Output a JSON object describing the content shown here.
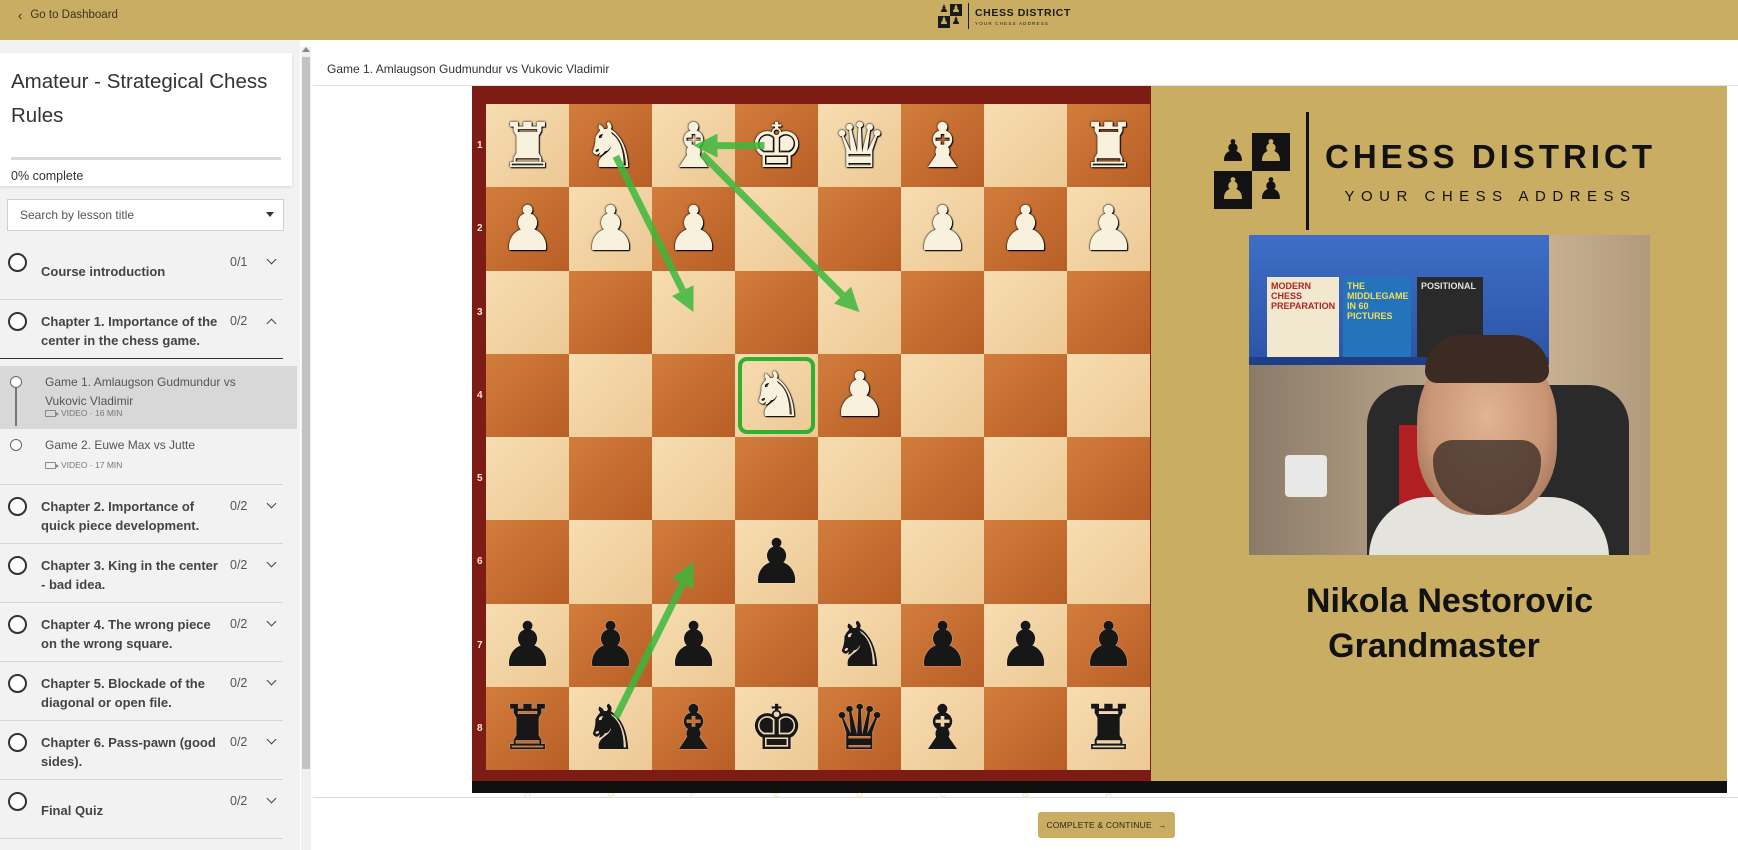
{
  "topbar": {
    "back_label": "Go to Dashboard",
    "logo_title": "CHESS DISTRICT",
    "logo_subtitle": "YOUR CHESS ADDRESS"
  },
  "course": {
    "title": "Amateur - Strategical Chess Rules",
    "progress_percent": 0,
    "progress_value": "0%",
    "progress_label": "complete"
  },
  "search": {
    "placeholder": "Search by lesson title"
  },
  "chapters": [
    {
      "label": "Course introduction",
      "count": "0/1",
      "expanded": false
    },
    {
      "label": "Chapter 1. Importance of the center in the chess game.",
      "count": "0/2",
      "expanded": true,
      "lessons": [
        {
          "title": "Game 1. Amlaugson Gudmundur vs Vukovic Vladimir",
          "meta": "VIDEO · 16 MIN",
          "active": true
        },
        {
          "title": "Game 2. Euwe Max vs Jutte",
          "meta": "VIDEO · 17 MIN",
          "active": false
        }
      ]
    },
    {
      "label": "Chapter 2. Importance of quick piece development.",
      "count": "0/2",
      "expanded": false
    },
    {
      "label": "Chapter 3. King in the center - bad idea.",
      "count": "0/2",
      "expanded": false
    },
    {
      "label": "Chapter 4. The wrong piece on the wrong square.",
      "count": "0/2",
      "expanded": false
    },
    {
      "label": "Chapter 5. Blockade of the diagonal or open file.",
      "count": "0/2",
      "expanded": false
    },
    {
      "label": "Chapter 6. Pass-pawn (good sides).",
      "count": "0/2",
      "expanded": false
    },
    {
      "label": "Final Quiz",
      "count": "0/2",
      "expanded": false
    }
  ],
  "main": {
    "lesson_title": "Game 1. Amlaugson Gudmundur vs Vukovic Vladimir"
  },
  "board": {
    "ranks": [
      "1",
      "2",
      "3",
      "4",
      "5",
      "6",
      "7",
      "8"
    ],
    "files": [
      "H",
      "G",
      "F",
      "E",
      "D",
      "C",
      "B",
      "A"
    ],
    "pieces": [
      {
        "sq": "H1",
        "glyph": "♜",
        "color": "w",
        "name": "white-rook"
      },
      {
        "sq": "G1",
        "glyph": "♞",
        "color": "w",
        "name": "white-knight"
      },
      {
        "sq": "F1",
        "glyph": "♝",
        "color": "w",
        "name": "white-bishop"
      },
      {
        "sq": "E1",
        "glyph": "♚",
        "color": "w",
        "name": "white-king"
      },
      {
        "sq": "D1",
        "glyph": "♛",
        "color": "w",
        "name": "white-queen"
      },
      {
        "sq": "C1",
        "glyph": "♝",
        "color": "w",
        "name": "white-bishop"
      },
      {
        "sq": "A1",
        "glyph": "♜",
        "color": "w",
        "name": "white-rook"
      },
      {
        "sq": "H2",
        "glyph": "♟",
        "color": "w",
        "name": "white-pawn"
      },
      {
        "sq": "G2",
        "glyph": "♟",
        "color": "w",
        "name": "white-pawn"
      },
      {
        "sq": "F2",
        "glyph": "♟",
        "color": "w",
        "name": "white-pawn"
      },
      {
        "sq": "C2",
        "glyph": "♟",
        "color": "w",
        "name": "white-pawn"
      },
      {
        "sq": "B2",
        "glyph": "♟",
        "color": "w",
        "name": "white-pawn"
      },
      {
        "sq": "A2",
        "glyph": "♟",
        "color": "w",
        "name": "white-pawn"
      },
      {
        "sq": "E4",
        "glyph": "♞",
        "color": "w",
        "name": "white-knight"
      },
      {
        "sq": "D4",
        "glyph": "♟",
        "color": "w",
        "name": "white-pawn"
      },
      {
        "sq": "E6",
        "glyph": "♟",
        "color": "b",
        "name": "black-pawn"
      },
      {
        "sq": "H7",
        "glyph": "♟",
        "color": "b",
        "name": "black-pawn"
      },
      {
        "sq": "G7",
        "glyph": "♟",
        "color": "b",
        "name": "black-pawn"
      },
      {
        "sq": "F7",
        "glyph": "♟",
        "color": "b",
        "name": "black-pawn"
      },
      {
        "sq": "D7",
        "glyph": "♞",
        "color": "b",
        "name": "black-knight"
      },
      {
        "sq": "C7",
        "glyph": "♟",
        "color": "b",
        "name": "black-pawn"
      },
      {
        "sq": "B7",
        "glyph": "♟",
        "color": "b",
        "name": "black-pawn"
      },
      {
        "sq": "A7",
        "glyph": "♟",
        "color": "b",
        "name": "black-pawn"
      },
      {
        "sq": "H8",
        "glyph": "♜",
        "color": "b",
        "name": "black-rook"
      },
      {
        "sq": "G8",
        "glyph": "♞",
        "color": "b",
        "name": "black-knight"
      },
      {
        "sq": "F8",
        "glyph": "♝",
        "color": "b",
        "name": "black-bishop"
      },
      {
        "sq": "E8",
        "glyph": "♚",
        "color": "b",
        "name": "black-king"
      },
      {
        "sq": "D8",
        "glyph": "♛",
        "color": "b",
        "name": "black-queen"
      },
      {
        "sq": "C8",
        "glyph": "♝",
        "color": "b",
        "name": "black-bishop"
      },
      {
        "sq": "A8",
        "glyph": "♜",
        "color": "b",
        "name": "black-rook"
      }
    ],
    "highlight": "E4",
    "arrows": [
      {
        "from": "E1",
        "to": "F1"
      },
      {
        "from": "G1",
        "to": "F3"
      },
      {
        "from": "F1",
        "to": "D3"
      },
      {
        "from": "G8",
        "to": "F6"
      }
    ],
    "arrow_color": "#3cb83c"
  },
  "promo": {
    "logo_title": "CHESS DISTRICT",
    "logo_subtitle": "YOUR CHESS ADDRESS",
    "book1": "MODERN CHESS PREPARATION",
    "book2": "THE MIDDLEGAME IN 60 PICTURES",
    "book3": "POSITIONAL",
    "host_name": "Nikola Nestorovic",
    "host_title": "Grandmaster"
  },
  "footer": {
    "button_label": "COMPLETE & CONTINUE",
    "button_arrow": "→"
  },
  "colors": {
    "brand_gold": "#c9ad62",
    "board_frame": "#7d1c14",
    "highlight_green": "#2fb12f"
  }
}
